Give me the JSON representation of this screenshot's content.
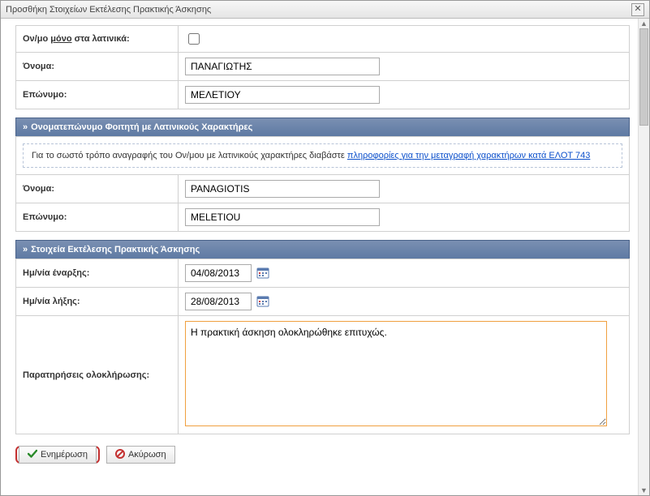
{
  "window": {
    "title": "Προσθήκη Στοιχείων Εκτέλεσης Πρακτικής Άσκησης"
  },
  "greek_name": {
    "latin_only_label_prefix": "Ον/μο ",
    "latin_only_label_underlined": "μόνο",
    "latin_only_label_suffix": " στα λατινικά:",
    "first_label": "Όνομα:",
    "first_value": "ΠΑΝΑΓΙΩΤΗΣ",
    "last_label": "Επώνυμο:",
    "last_value": "ΜΕΛΕΤΙΟΥ"
  },
  "latin_section": {
    "header": "Ονοματεπώνυμο Φοιτητή με Λατινικούς Χαρακτήρες",
    "info_prefix": "Για το σωστό τρόπο αναγραφής του Ον/μου με λατινικούς χαρακτήρες διαβάστε ",
    "info_link": "πληροφορίες για την μεταγραφή χαρακτήρων κατά ΕΛΟΤ 743",
    "first_label": "Όνομα:",
    "first_value": "PANAGIOTIS",
    "last_label": "Επώνυμο:",
    "last_value": "MELETIOU"
  },
  "execution_section": {
    "header": "Στοιχεία Εκτέλεσης Πρακτικής Άσκησης",
    "start_date_label": "Ημ/νία έναρξης:",
    "start_date_value": "04/08/2013",
    "end_date_label": "Ημ/νία λήξης:",
    "end_date_value": "28/08/2013",
    "notes_label": "Παρατηρήσεις ολοκλήρωσης:",
    "notes_value": "Η πρακτική άσκηση ολοκληρώθηκε επιτυχώς."
  },
  "buttons": {
    "update": "Ενημέρωση",
    "cancel": "Ακύρωση"
  }
}
